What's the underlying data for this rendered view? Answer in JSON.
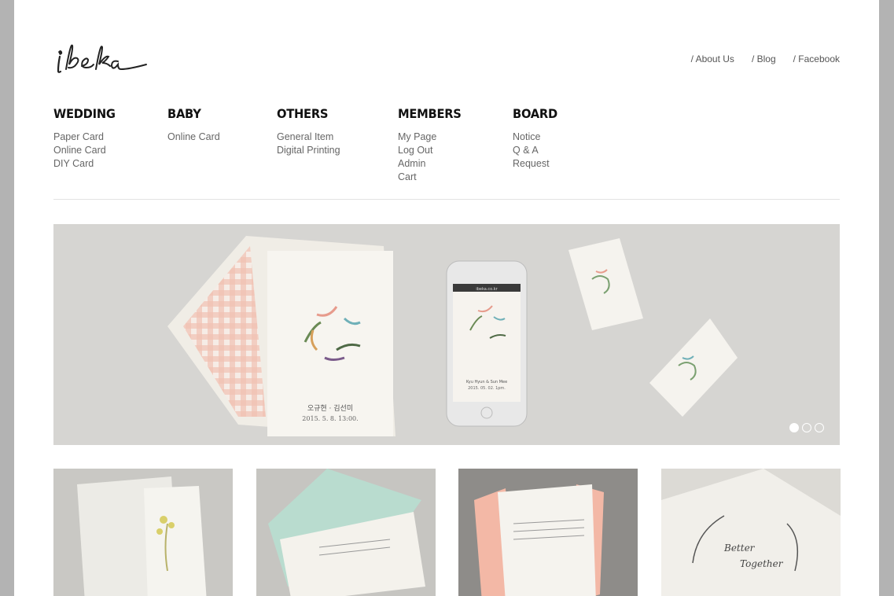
{
  "brand": {
    "logo_text": "ibeka"
  },
  "top_links": [
    "/ About Us",
    "/ Blog",
    "/ Facebook"
  ],
  "nav": [
    {
      "title": "WEDDING",
      "items": [
        "Paper Card",
        "Online Card",
        "DIY Card"
      ]
    },
    {
      "title": "BABY",
      "items": [
        "Online Card"
      ]
    },
    {
      "title": "OTHERS",
      "items": [
        "General Item",
        "Digital Printing"
      ]
    },
    {
      "title": "MEMBERS",
      "items": [
        "My Page",
        "Log Out",
        "Admin",
        "Cart"
      ]
    },
    {
      "title": "BOARD",
      "items": [
        "Notice",
        "Q & A",
        "Request"
      ]
    }
  ],
  "hero": {
    "card_text_line1": "오규현 · 김선미",
    "card_text_line2": "2015. 5. 8. 13:00.",
    "phone_text_line1": "Kyu Hyun & Sun Mee",
    "phone_text_line2": "2015. 05. 02. 1pm.",
    "phone_url": "ibeka.co.kr",
    "slides": 3,
    "active_slide": 0
  },
  "thumb_text": {
    "better": "Better",
    "together": "Together"
  },
  "colors": {
    "page_bg": "#ffffff",
    "outer_bg": "#b3b3b3",
    "hero_bg": "#d6d5d2",
    "nav_text": "#666666",
    "heading": "#111111"
  }
}
